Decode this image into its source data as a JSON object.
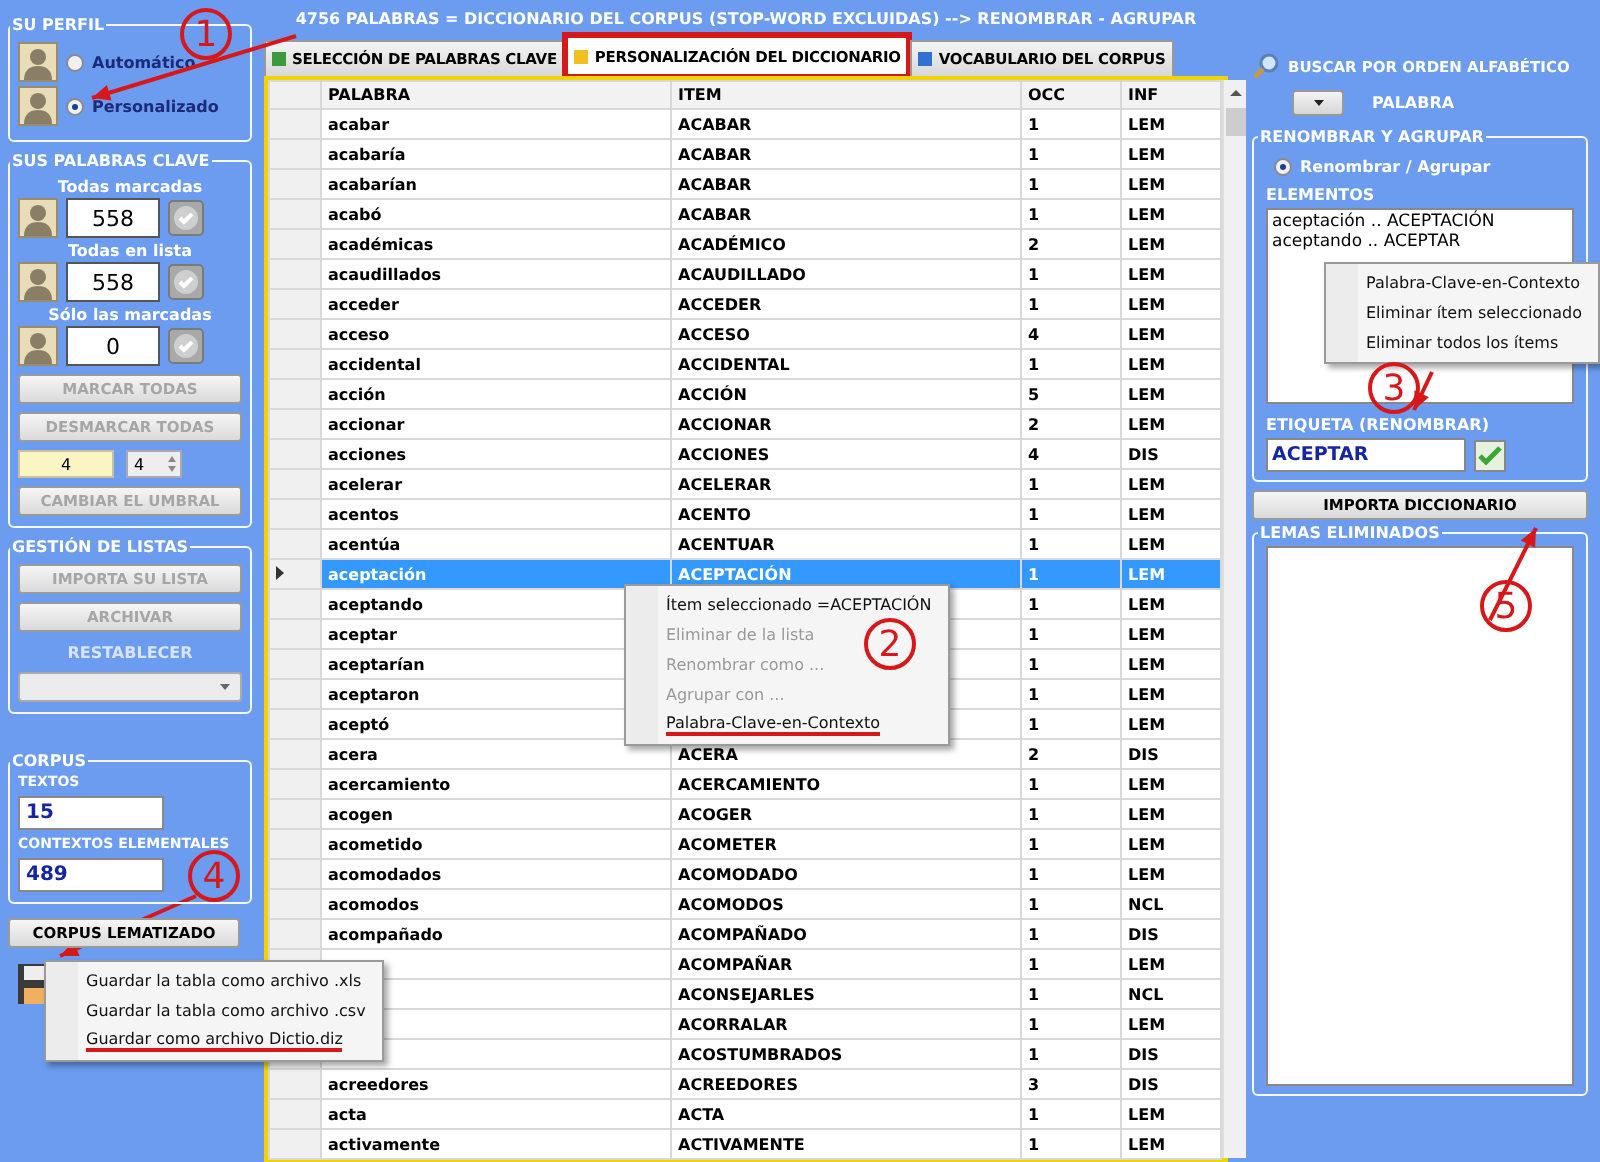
{
  "title": "4756 PALABRAS = DICCIONARIO DEL CORPUS (STOP-WORD EXCLUIDAS) --> RENOMBRAR - AGRUPAR",
  "tabs": [
    {
      "label": "SELECCIÓN DE PALABRAS CLAVE",
      "selected": false,
      "highlighted": false,
      "color": "#3c9a3c"
    },
    {
      "label": "PERSONALIZACIÓN DEL DICCIONARIO",
      "selected": true,
      "highlighted": true,
      "color": "#f0c020"
    },
    {
      "label": "VOCABULARIO DEL CORPUS",
      "selected": false,
      "highlighted": false,
      "color": "#3070d0"
    }
  ],
  "profile": {
    "title": "SU PERFIL",
    "options": [
      {
        "label": "Automático",
        "selected": false
      },
      {
        "label": "Personalizado",
        "selected": true
      }
    ]
  },
  "keywords": {
    "title": "SUS PALABRAS CLAVE",
    "counters": [
      {
        "label": "Todas marcadas",
        "value": "558"
      },
      {
        "label": "Todas en lista",
        "value": "558"
      },
      {
        "label": "Sólo las marcadas",
        "value": "0"
      }
    ],
    "buttons": [
      {
        "label": "MARCAR TODAS",
        "disabled": true
      },
      {
        "label": "DESMARCAR TODAS",
        "disabled": true
      }
    ],
    "threshold": {
      "value": "4",
      "spin_value": "4"
    },
    "threshold_button": {
      "label": "CAMBIAR EL UMBRAL",
      "disabled": true
    }
  },
  "lists": {
    "title": "GESTIÓN DE LISTAS",
    "buttons": [
      {
        "label": "IMPORTA SU LISTA",
        "disabled": true
      },
      {
        "label": "ARCHIVAR",
        "disabled": true
      }
    ],
    "restore_label": "RESTABLECER"
  },
  "corpus": {
    "title": "CORPUS",
    "fields": [
      {
        "label": "TEXTOS",
        "value": "15"
      },
      {
        "label": "CONTEXTOS ELEMENTALES",
        "value": "489"
      }
    ]
  },
  "lemmatized_button": "CORPUS LEMATIZADO",
  "save_menu": {
    "items": [
      {
        "label": "Guardar la tabla como archivo .xls",
        "underlined": false
      },
      {
        "label": "Guardar la tabla como archivo .csv",
        "underlined": false
      },
      {
        "label": "Guardar como archivo Dictio.diz",
        "underlined": true
      }
    ]
  },
  "table": {
    "columns": [
      "PALABRA",
      "ITEM",
      "OCC",
      "INF"
    ],
    "rows": [
      {
        "palabra": "acabar",
        "item": "ACABAR",
        "occ": "1",
        "inf": "LEM",
        "selected": false
      },
      {
        "palabra": "acabaría",
        "item": "ACABAR",
        "occ": "1",
        "inf": "LEM",
        "selected": false
      },
      {
        "palabra": "acabarían",
        "item": "ACABAR",
        "occ": "1",
        "inf": "LEM",
        "selected": false
      },
      {
        "palabra": "acabó",
        "item": "ACABAR",
        "occ": "1",
        "inf": "LEM",
        "selected": false
      },
      {
        "palabra": "académicas",
        "item": "ACADÉMICO",
        "occ": "2",
        "inf": "LEM",
        "selected": false
      },
      {
        "palabra": "acaudillados",
        "item": "ACAUDILLADO",
        "occ": "1",
        "inf": "LEM",
        "selected": false
      },
      {
        "palabra": "acceder",
        "item": "ACCEDER",
        "occ": "1",
        "inf": "LEM",
        "selected": false
      },
      {
        "palabra": "acceso",
        "item": "ACCESO",
        "occ": "4",
        "inf": "LEM",
        "selected": false
      },
      {
        "palabra": "accidental",
        "item": "ACCIDENTAL",
        "occ": "1",
        "inf": "LEM",
        "selected": false
      },
      {
        "palabra": "acción",
        "item": "ACCIÓN",
        "occ": "5",
        "inf": "LEM",
        "selected": false
      },
      {
        "palabra": "accionar",
        "item": "ACCIONAR",
        "occ": "2",
        "inf": "LEM",
        "selected": false
      },
      {
        "palabra": "acciones",
        "item": "ACCIONES",
        "occ": "4",
        "inf": "DIS",
        "selected": false
      },
      {
        "palabra": "acelerar",
        "item": "ACELERAR",
        "occ": "1",
        "inf": "LEM",
        "selected": false
      },
      {
        "palabra": "acentos",
        "item": "ACENTO",
        "occ": "1",
        "inf": "LEM",
        "selected": false
      },
      {
        "palabra": "acentúa",
        "item": "ACENTUAR",
        "occ": "1",
        "inf": "LEM",
        "selected": false
      },
      {
        "palabra": "aceptación",
        "item": "ACEPTACIÓN",
        "occ": "1",
        "inf": "LEM",
        "selected": true
      },
      {
        "palabra": "aceptando",
        "occ": "1",
        "inf": "LEM",
        "selected": false
      },
      {
        "palabra": "aceptar",
        "occ": "1",
        "inf": "LEM",
        "selected": false
      },
      {
        "palabra": "aceptarían",
        "occ": "1",
        "inf": "LEM",
        "selected": false
      },
      {
        "palabra": "aceptaron",
        "occ": "1",
        "inf": "LEM",
        "selected": false
      },
      {
        "palabra": "aceptó",
        "occ": "1",
        "inf": "LEM",
        "selected": false
      },
      {
        "palabra": "acera",
        "item": "ACERA",
        "occ": "2",
        "inf": "DIS",
        "selected": false
      },
      {
        "palabra": "acercamiento",
        "item": "ACERCAMIENTO",
        "occ": "1",
        "inf": "LEM",
        "selected": false
      },
      {
        "palabra": "acogen",
        "item": "ACOGER",
        "occ": "1",
        "inf": "LEM",
        "selected": false
      },
      {
        "palabra": "acometido",
        "item": "ACOMETER",
        "occ": "1",
        "inf": "LEM",
        "selected": false
      },
      {
        "palabra": "acomodados",
        "item": "ACOMODADO",
        "occ": "1",
        "inf": "LEM",
        "selected": false
      },
      {
        "palabra": "acomodos",
        "item": "ACOMODOS",
        "occ": "1",
        "inf": "NCL",
        "selected": false
      },
      {
        "palabra": "acompañado",
        "item": "ACOMPAÑADO",
        "occ": "1",
        "inf": "DIS",
        "selected": false
      },
      {
        "item": "ACOMPAÑAR",
        "occ": "1",
        "inf": "LEM",
        "selected": false
      },
      {
        "item": "ACONSEJARLES",
        "occ": "1",
        "inf": "NCL",
        "selected": false
      },
      {
        "item": "ACORRALAR",
        "occ": "1",
        "inf": "LEM",
        "selected": false
      },
      {
        "item": "ACOSTUMBRADOS",
        "occ": "1",
        "inf": "DIS",
        "selected": false
      },
      {
        "palabra": "acreedores",
        "item": "ACREEDORES",
        "occ": "3",
        "inf": "DIS",
        "selected": false
      },
      {
        "palabra": "acta",
        "item": "ACTA",
        "occ": "1",
        "inf": "LEM",
        "selected": false
      },
      {
        "palabra": "activamente",
        "item": "ACTIVAMENTE",
        "occ": "1",
        "inf": "LEM",
        "selected": false
      }
    ]
  },
  "row_menu": {
    "items": [
      {
        "label": "Ítem seleccionado =ACEPTACIÓN",
        "disabled": false,
        "underlined": false
      },
      {
        "label": "Eliminar de la lista",
        "disabled": true,
        "underlined": false
      },
      {
        "label": "Renombrar como ...",
        "disabled": true,
        "underlined": false
      },
      {
        "label": "Agrupar con ...",
        "disabled": true,
        "underlined": false
      },
      {
        "label": "Palabra-Clave-en-Contexto",
        "disabled": false,
        "underlined": true
      }
    ]
  },
  "search": {
    "label": "BUSCAR POR ORDEN ALFABÉTICO",
    "field_label": "PALABRA"
  },
  "rename": {
    "title": "RENOMBRAR Y AGRUPAR",
    "option": {
      "label": "Renombrar / Agrupar",
      "selected": true
    },
    "elements_label": "ELEMENTOS",
    "elements": [
      "aceptación .. ACEPTACIÓN",
      "aceptando .. ACEPTAR"
    ],
    "tag_label": "ETIQUETA (RENOMBRAR)",
    "tag_value": "ACEPTAR"
  },
  "elements_menu": {
    "items": [
      {
        "label": "Palabra-Clave-en-Contexto",
        "disabled": false,
        "underlined": false
      },
      {
        "label": "Eliminar ítem seleccionado",
        "disabled": false,
        "underlined": false
      },
      {
        "label": "Eliminar todos los ítems",
        "disabled": false,
        "underlined": false
      }
    ]
  },
  "import_button": "IMPORTA DICCIONARIO",
  "removed": {
    "title": "LEMAS ELIMINADOS"
  },
  "annotations": [
    {
      "label": "1"
    },
    {
      "label": "2"
    },
    {
      "label": "3"
    },
    {
      "label": "4"
    },
    {
      "label": "5"
    }
  ]
}
